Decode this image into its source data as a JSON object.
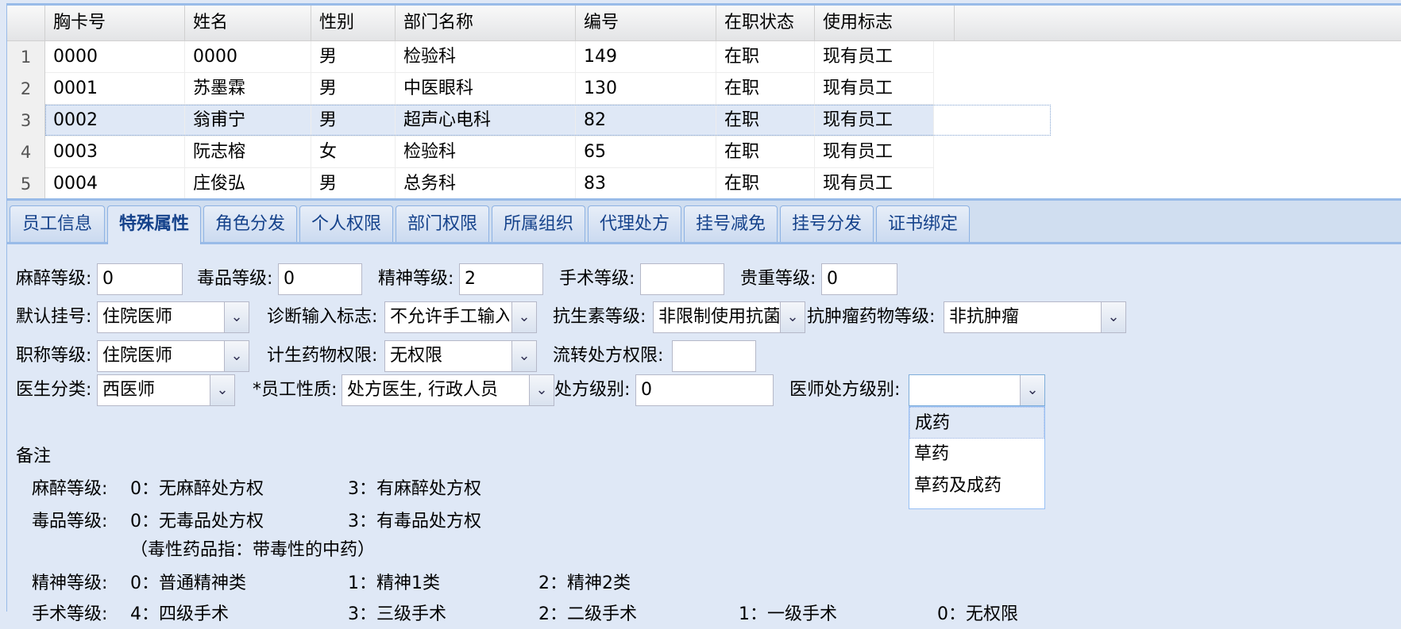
{
  "grid": {
    "columns": [
      "胸卡号",
      "姓名",
      "性别",
      "部门名称",
      "编号",
      "在职状态",
      "使用标志"
    ],
    "rows": [
      {
        "n": "1",
        "cells": [
          "0000",
          "0000",
          "男",
          "检验科",
          "149",
          "在职",
          "现有员工"
        ]
      },
      {
        "n": "2",
        "cells": [
          "0001",
          "苏墨霖",
          "男",
          "中医眼科",
          "130",
          "在职",
          "现有员工"
        ]
      },
      {
        "n": "3",
        "cells": [
          "0002",
          "翁甫宁",
          "男",
          "超声心电科",
          "82",
          "在职",
          "现有员工"
        ]
      },
      {
        "n": "4",
        "cells": [
          "0003",
          "阮志榕",
          "女",
          "检验科",
          "65",
          "在职",
          "现有员工"
        ]
      },
      {
        "n": "5",
        "cells": [
          "0004",
          "庄俊弘",
          "男",
          "总务科",
          "83",
          "在职",
          "现有员工"
        ]
      }
    ],
    "selected_row": "3"
  },
  "tabs": [
    "员工信息",
    "特殊属性",
    "角色分发",
    "个人权限",
    "部门权限",
    "所属组织",
    "代理处方",
    "挂号减免",
    "挂号分发",
    "证书绑定"
  ],
  "active_tab": "特殊属性",
  "form": {
    "anesthesia_label": "麻醉等级:",
    "anesthesia_value": "0",
    "poison_label": "毒品等级:",
    "poison_value": "0",
    "mental_label": "精神等级:",
    "mental_value": "2",
    "surgery_label": "手术等级:",
    "surgery_value": "",
    "precious_label": "贵重等级:",
    "precious_value": "0",
    "default_reg_label": "默认挂号:",
    "default_reg_value": "住院医师",
    "diag_input_label": "诊断输入标志:",
    "diag_input_value": "不允许手工输入",
    "antibiotic_label": "抗生素等级:",
    "antibiotic_value": "非限制使用抗菌",
    "antitumor_label": "抗肿瘤药物等级:",
    "antitumor_value": "非抗肿瘤",
    "title_level_label": "职称等级:",
    "title_level_value": "住院医师",
    "family_plan_label": "计生药物权限:",
    "family_plan_value": "无权限",
    "transfer_rx_label": "流转处方权限:",
    "transfer_rx_value": "",
    "doctor_type_label": "医生分类:",
    "doctor_type_value": "西医师",
    "staff_nature_label": "*员工性质:",
    "staff_nature_value": "处方医生, 行政人员",
    "rx_level_label": "处方级别:",
    "rx_level_value": "0",
    "doctor_rx_level_label": "医师处方级别:",
    "doctor_rx_level_value": ""
  },
  "dropdown": {
    "options": [
      "成药",
      "草药",
      "草药及成药"
    ],
    "highlighted": "成药"
  },
  "notes": {
    "title": "备注",
    "anesthesia": {
      "label": "麻醉等级:",
      "a": "0：无麻醉处方权",
      "b": "3：有麻醉处方权"
    },
    "poison": {
      "label": "毒品等级:",
      "a": "0：无毒品处方权",
      "b": "3：有毒品处方权",
      "c": "（毒性药品指：带毒性的中药）"
    },
    "mental": {
      "label": "精神等级:",
      "a": "0：普通精神类",
      "b": "1：精神1类",
      "c": "2：精神2类"
    },
    "surgery": {
      "label": "手术等级:",
      "a": "4：四级手术",
      "b": "3：三级手术",
      "c": "2：二级手术",
      "d": "1：一级手术",
      "e": "0：无权限"
    }
  },
  "colors": {
    "accent_border": "#99bbe8",
    "panel_bg": "#dfe8f6",
    "tab_text": "#15428b"
  }
}
